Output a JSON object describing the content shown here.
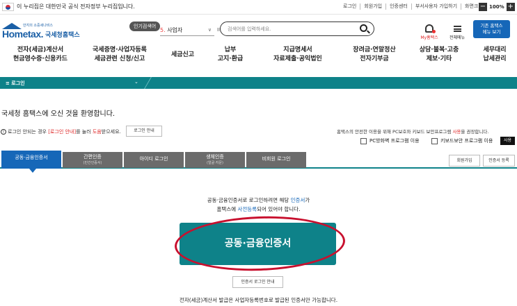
{
  "govbar": {
    "text": "이 누리집은 대한민국 공식 전자정부 누리집입니다.",
    "links": [
      "로그인",
      "회원가입",
      "인증센터",
      "부서사용자 가입하기",
      "화면크기"
    ],
    "zoom_minus": "−",
    "zoom_value": "100%",
    "zoom_plus": "+"
  },
  "header": {
    "logo_small": "안지의 소중세나비스",
    "logo_main": "Hometax.",
    "logo_kr": "국세청홈택스",
    "popular_label": "인기검색어",
    "popular_num": "5.",
    "popular_word": "사업자",
    "search_placeholder": "검색어를 입력하세요.",
    "my_label": "My홈택스",
    "allmenu_label": "전체메뉴",
    "oldhome_line1": "기존 홈택스",
    "oldhome_line2": "메뉴 보기"
  },
  "nav": [
    {
      "l1": "전자(세금)계산서",
      "l2": "현금영수증·신용카드"
    },
    {
      "l1": "국세증명·사업자등록",
      "l2": "세금관련 신청/신고"
    },
    {
      "l1": "세금신고",
      "l2": ""
    },
    {
      "l1": "납부",
      "l2": "고지·환급"
    },
    {
      "l1": "지급명세서",
      "l2": "자료제출·공익법인"
    },
    {
      "l1": "장려금·연말정산",
      "l2": "전자기부금"
    },
    {
      "l1": "상담·불복·고충",
      "l2": "제보·기타"
    },
    {
      "l1": "세무대리",
      "l2": "납세관리"
    }
  ],
  "loginbar": {
    "label": "≡  로그인",
    "chevron": "⌄"
  },
  "welcome": "국세청 홈택스에 오신 것을 환영합니다.",
  "help": {
    "icon": "!",
    "pre": "로그인 안되는 경우 ",
    "link": "[로그인 안내]",
    "mid": "를 눌러 ",
    "link2": "도움",
    "post": "받으세요.",
    "button": "로그인 안내"
  },
  "security": {
    "pre": "홈택스의 안전한 이용을 위해 PC보호와 키보드 보안프로그램 ",
    "red": "사용",
    "post": "을 권장합니다.",
    "pc_label": "PC방화벽 프로그램 이용",
    "kb_label": "키보드보안 프로그램 이용",
    "use_button": "사용"
  },
  "tabs": [
    {
      "main": "공동·금융인증서",
      "sub": ""
    },
    {
      "main": "간편인증",
      "sub": "(민간인증서)"
    },
    {
      "main": "아이디 로그인",
      "sub": ""
    },
    {
      "main": "생체인증",
      "sub": "(얼굴·지문)"
    },
    {
      "main": "비회원 로그인",
      "sub": ""
    }
  ],
  "right_buttons": {
    "join": "회원가입",
    "cert_reg": "인증서 등록"
  },
  "content": {
    "line1_pre": "공동·금융인증서로 로그인하려면 해당 ",
    "line1_blue": "인증서",
    "line1_post": "가",
    "line2_pre": "홈택스에 ",
    "line2_blue": "사전등록",
    "line2_post": "되어 있어야 합니다.",
    "big_button": "공동·금융인증서",
    "guide_button": "인증서 로그인 안내",
    "bottom_note": "전자(세금)계산서 발급은 사업자등록번호로 발급된 인증서만 가능합니다."
  }
}
